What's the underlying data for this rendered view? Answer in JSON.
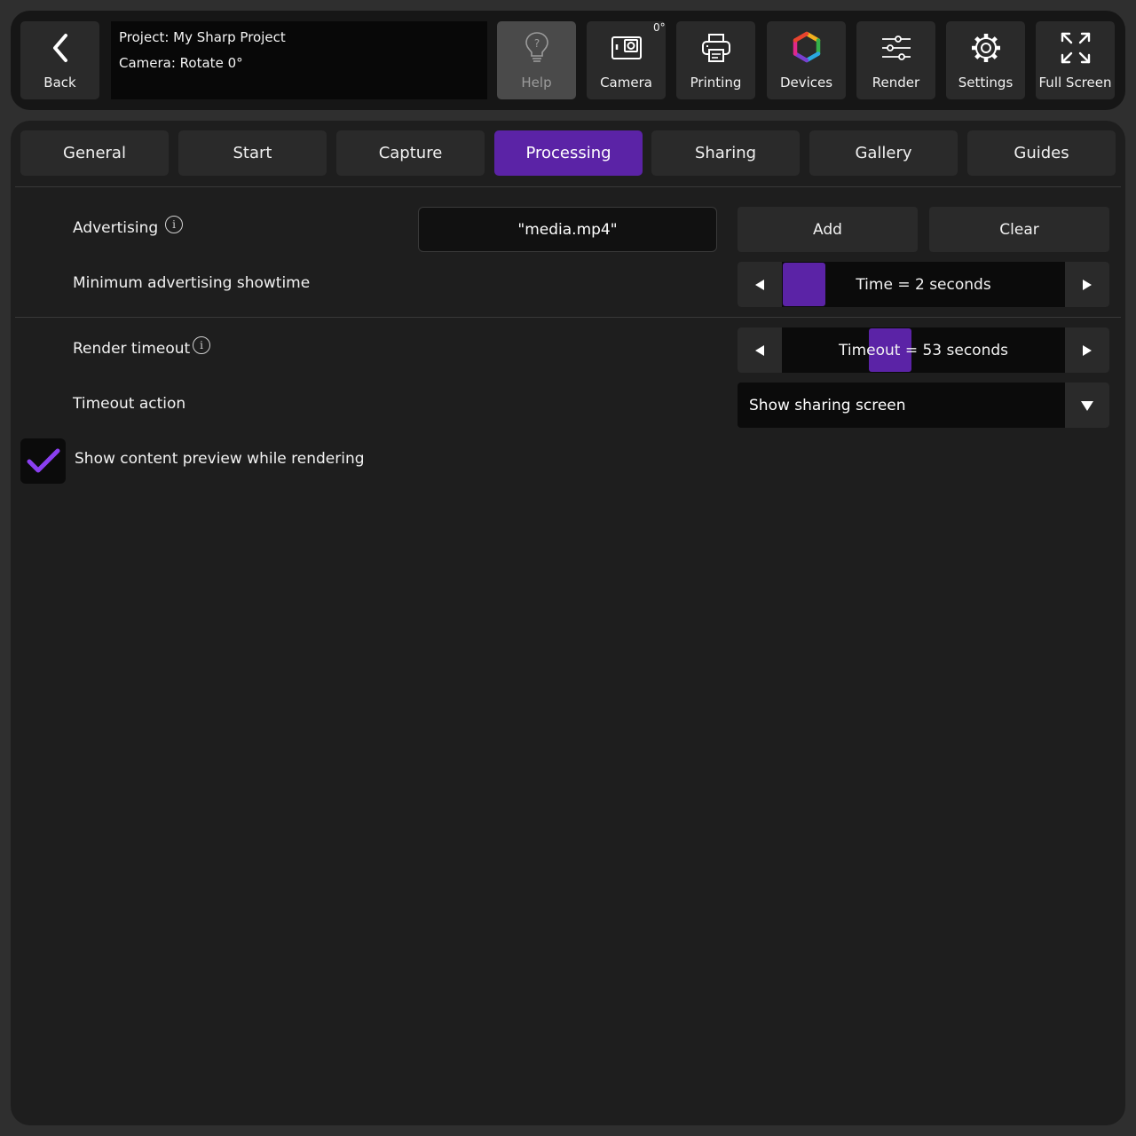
{
  "toolbar": {
    "back": {
      "label": "Back",
      "icon": "chevron-left-icon"
    },
    "info": {
      "project": "Project: My Sharp Project",
      "camera": "Camera: Rotate 0°"
    },
    "help": {
      "label": "Help",
      "icon": "lightbulb-question-icon",
      "disabled": true
    },
    "camera": {
      "label": "Camera",
      "icon": "camera-icon",
      "badge": "0°"
    },
    "printing": {
      "label": "Printing",
      "icon": "printer-icon"
    },
    "devices": {
      "label": "Devices",
      "icon": "devices-hexagon-icon"
    },
    "render": {
      "label": "Render",
      "icon": "sliders-icon"
    },
    "settings": {
      "label": "Settings",
      "icon": "gear-icon"
    },
    "fullscreen": {
      "label": "Full Screen",
      "icon": "expand-icon"
    }
  },
  "tabs": [
    {
      "label": "General"
    },
    {
      "label": "Start"
    },
    {
      "label": "Capture"
    },
    {
      "label": "Processing",
      "active": true
    },
    {
      "label": "Sharing"
    },
    {
      "label": "Gallery"
    },
    {
      "label": "Guides"
    }
  ],
  "advertising": {
    "label": "Advertising",
    "file": "\"media.mp4\"",
    "add_label": "Add",
    "clear_label": "Clear"
  },
  "min_showtime": {
    "label": "Minimum advertising showtime",
    "text": "Time =  2 seconds",
    "value_seconds": 2,
    "level": 0.0
  },
  "render_timeout": {
    "label": "Render timeout",
    "text": "Timeout =  53 seconds",
    "value_seconds": 53,
    "level": 0.36
  },
  "timeout_action": {
    "label": "Timeout action",
    "selected": "Show sharing screen"
  },
  "preview": {
    "label": "Show content preview while rendering",
    "checked": true
  },
  "colors": {
    "accent": "#5b23a6",
    "check": "#8a3ff0",
    "background": "#1e1e1e",
    "button": "#2a2a2a"
  }
}
